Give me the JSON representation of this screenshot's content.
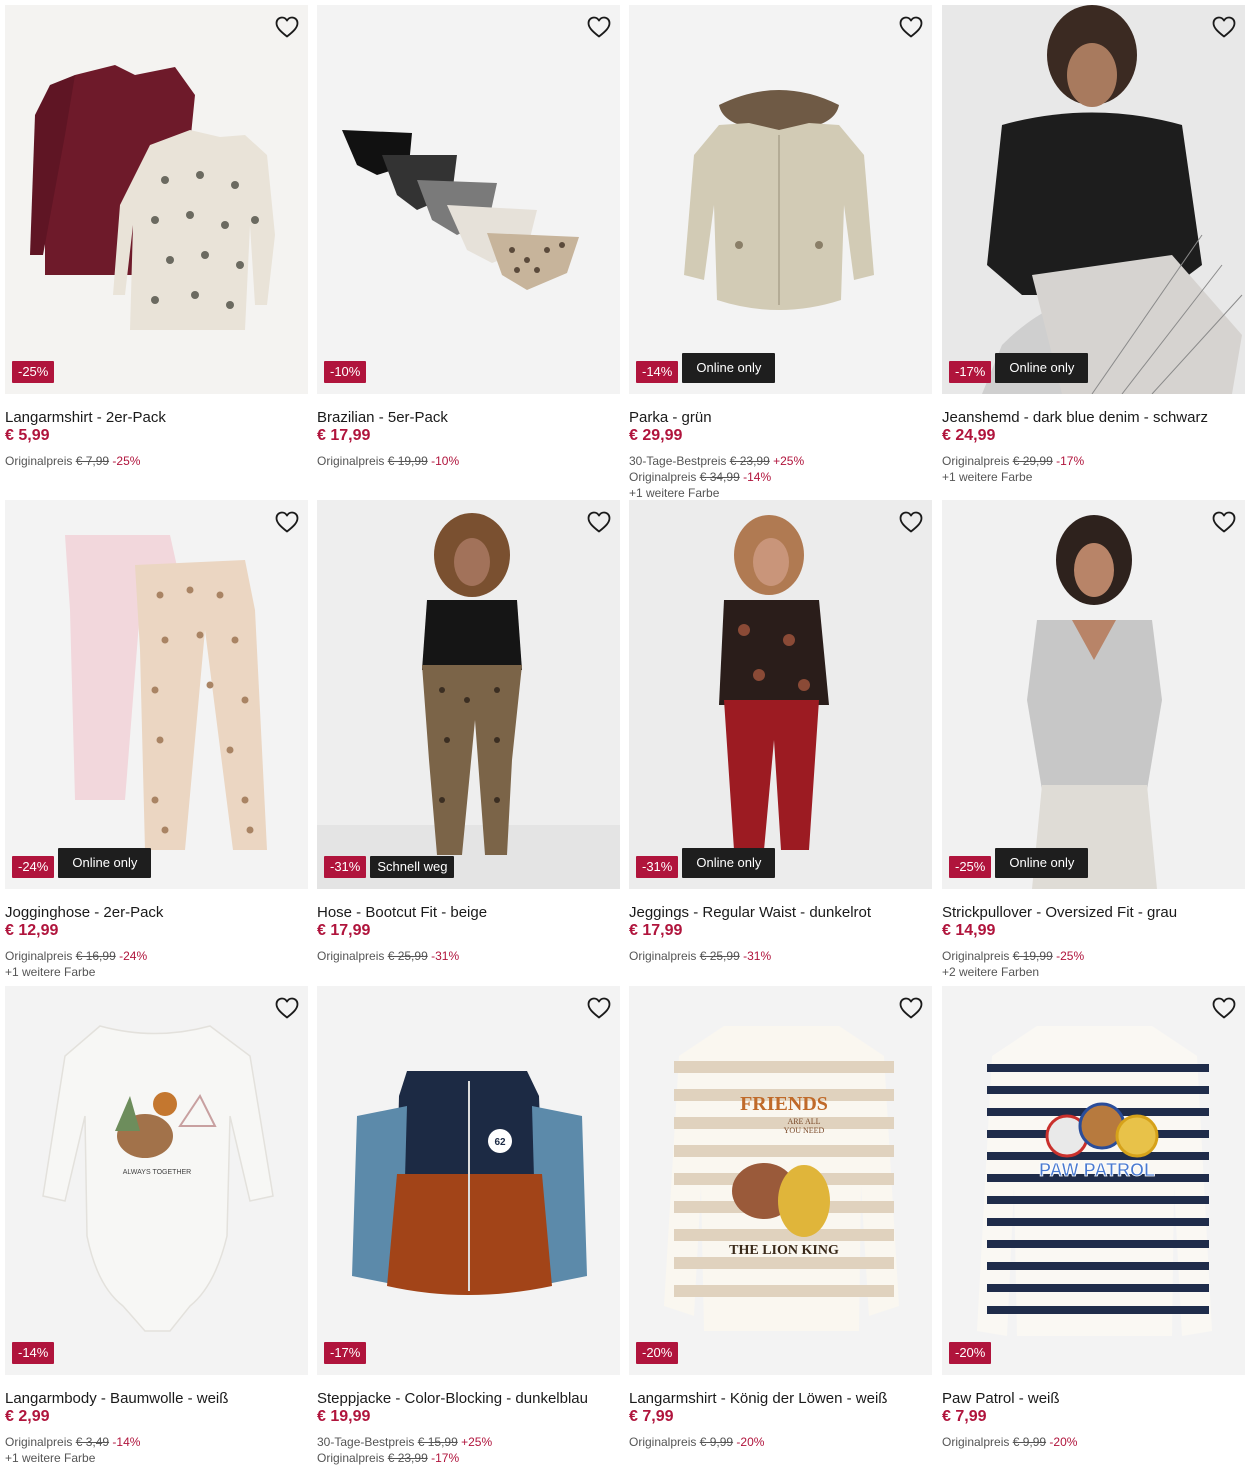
{
  "colors": {
    "accent": "#b0143c",
    "tag_bg": "#1e1e1e",
    "image_bg": "#f3f3f3"
  },
  "products": [
    {
      "title": "Langarmshirt - 2er-Pack",
      "price": "€ 5,99",
      "discount": "-25%",
      "tag": "",
      "meta": [
        {
          "label": "Originalpreis",
          "old": "€ 7,99",
          "pct": "-25%"
        }
      ],
      "extra": "",
      "illustration": "two-longsleeve-shirts"
    },
    {
      "title": "Brazilian - 5er-Pack",
      "price": "€ 17,99",
      "discount": "-10%",
      "tag": "",
      "meta": [
        {
          "label": "Originalpreis",
          "old": "€ 19,99",
          "pct": "-10%"
        }
      ],
      "extra": "",
      "illustration": "five-briefs"
    },
    {
      "title": "Parka - grün",
      "price": "€ 29,99",
      "discount": "-14%",
      "tag": "Online only",
      "meta": [
        {
          "label": "30-Tage-Bestpreis",
          "old": "€ 23,99",
          "pct": "+25%"
        },
        {
          "label": "Originalpreis",
          "old": "€ 34,99",
          "pct": "-14%"
        }
      ],
      "extra": "+1 weitere Farbe",
      "illustration": "parka-fur-hood"
    },
    {
      "title": "Jeanshemd - dark blue denim - schwarz",
      "price": "€ 24,99",
      "discount": "-17%",
      "tag": "Online only",
      "meta": [
        {
          "label": "Originalpreis",
          "old": "€ 29,99",
          "pct": "-17%"
        }
      ],
      "extra": "+1 weitere Farbe",
      "illustration": "model-denim-shirt"
    },
    {
      "title": "Jogginghose - 2er-Pack",
      "price": "€ 12,99",
      "discount": "-24%",
      "tag": "Online only",
      "meta": [
        {
          "label": "Originalpreis",
          "old": "€ 16,99",
          "pct": "-24%"
        }
      ],
      "extra": "+1 weitere Farbe",
      "illustration": "two-jogging-pants"
    },
    {
      "title": "Hose - Bootcut Fit - beige",
      "price": "€ 17,99",
      "discount": "-31%",
      "tag": "Schnell weg",
      "meta": [
        {
          "label": "Originalpreis",
          "old": "€ 25,99",
          "pct": "-31%"
        }
      ],
      "extra": "",
      "illustration": "model-leopard-bootcut"
    },
    {
      "title": "Jeggings - Regular Waist - dunkelrot",
      "price": "€ 17,99",
      "discount": "-31%",
      "tag": "Online only",
      "meta": [
        {
          "label": "Originalpreis",
          "old": "€ 25,99",
          "pct": "-31%"
        }
      ],
      "extra": "",
      "illustration": "model-red-jeggings"
    },
    {
      "title": "Strickpullover - Oversized Fit - grau",
      "price": "€ 14,99",
      "discount": "-25%",
      "tag": "Online only",
      "meta": [
        {
          "label": "Originalpreis",
          "old": "€ 19,99",
          "pct": "-25%"
        }
      ],
      "extra": "+2 weitere Farben",
      "illustration": "model-grey-knit-vest"
    },
    {
      "title": "Langarmbody - Baumwolle - weiß",
      "price": "€ 2,99",
      "discount": "-14%",
      "tag": "",
      "meta": [
        {
          "label": "Originalpreis",
          "old": "€ 3,49",
          "pct": "-14%"
        }
      ],
      "extra": "+1 weitere Farbe",
      "illustration": "baby-bodysuit"
    },
    {
      "title": "Steppjacke - Color-Blocking - dunkelblau",
      "price": "€ 19,99",
      "discount": "-17%",
      "tag": "",
      "meta": [
        {
          "label": "30-Tage-Bestpreis",
          "old": "€ 15,99",
          "pct": "+25%"
        },
        {
          "label": "Originalpreis",
          "old": "€ 23,99",
          "pct": "-17%"
        }
      ],
      "extra": "",
      "illustration": "puffer-jacket"
    },
    {
      "title": "Langarmshirt - König der Löwen - weiß",
      "price": "€ 7,99",
      "discount": "-20%",
      "tag": "",
      "meta": [
        {
          "label": "Originalpreis",
          "old": "€ 9,99",
          "pct": "-20%"
        }
      ],
      "extra": "",
      "illustration": "striped-lion-king-shirt"
    },
    {
      "title": "Paw Patrol - weiß",
      "price": "€ 7,99",
      "discount": "-20%",
      "tag": "",
      "meta": [
        {
          "label": "Originalpreis",
          "old": "€ 9,99",
          "pct": "-20%"
        }
      ],
      "extra": "",
      "illustration": "striped-paw-patrol-shirt"
    }
  ],
  "artwork_text": {
    "friends": "FRIENDS",
    "are_all": "ARE ALL",
    "you_need": "YOU NEED",
    "lion_king": "THE LION KING",
    "always_together": "ALWAYS TOGETHER",
    "jacket_patch": "62",
    "paw_patrol": "PAW PATROL"
  }
}
